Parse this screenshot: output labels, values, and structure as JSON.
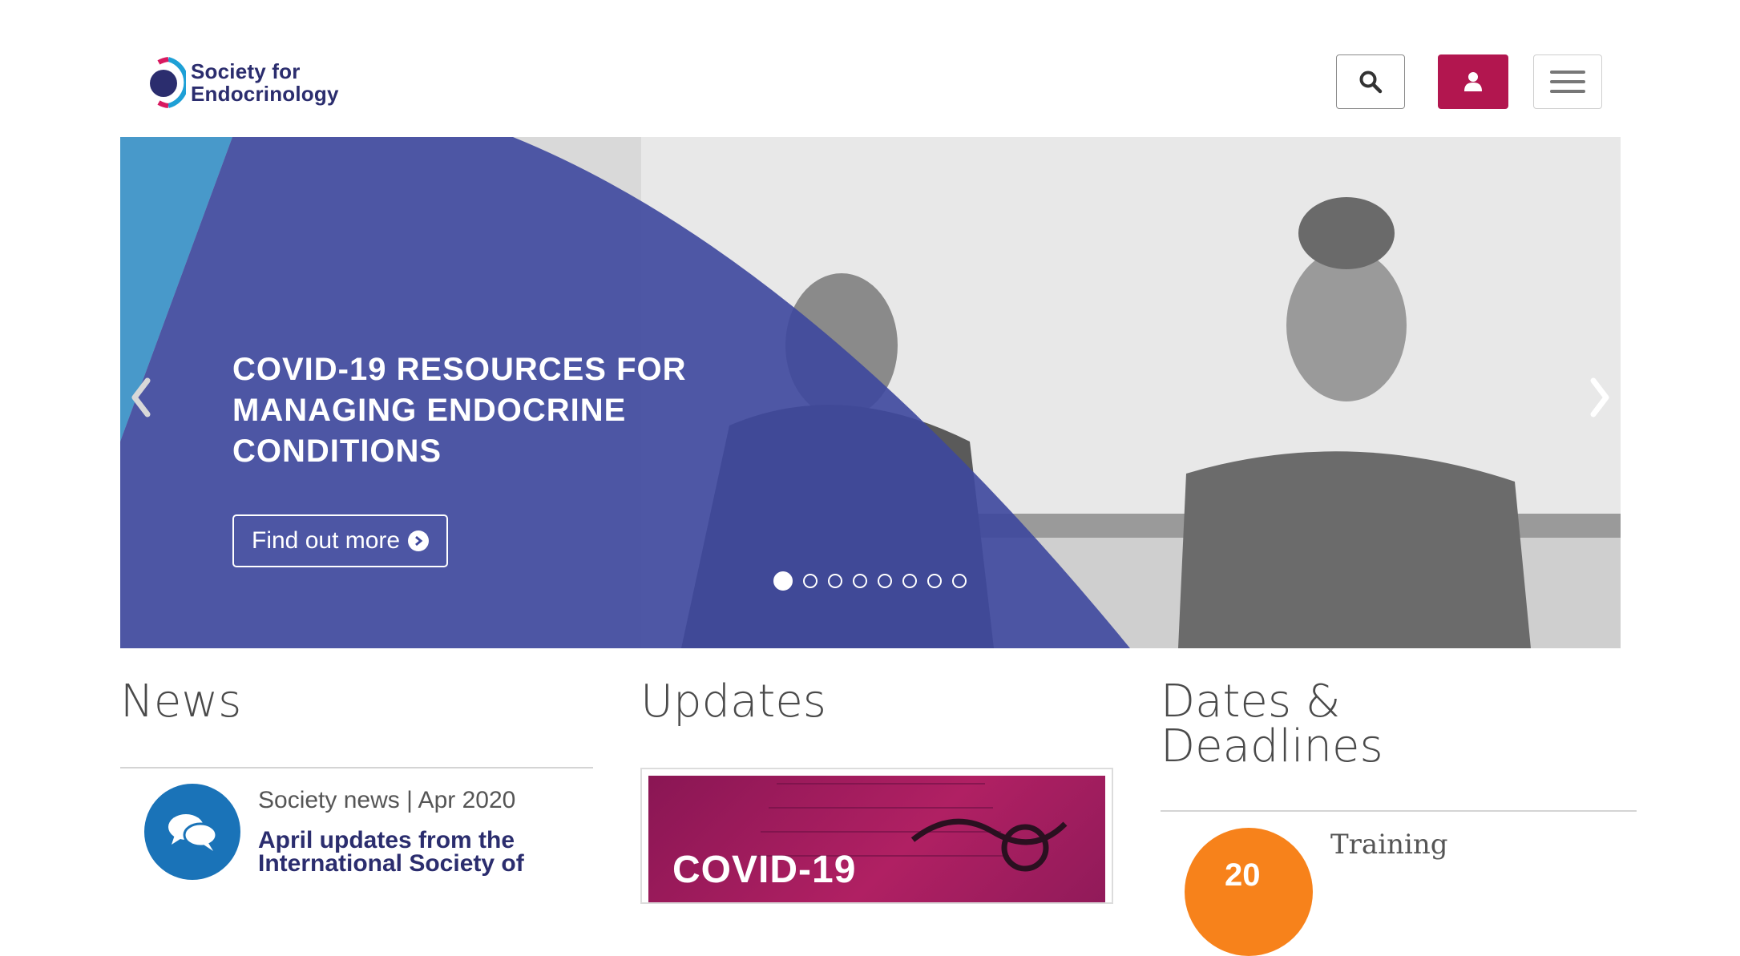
{
  "header": {
    "logo_line1": "Society for",
    "logo_line2": "Endocrinology",
    "icons": {
      "search": "search-icon",
      "user": "user-icon",
      "menu": "hamburger-menu-icon"
    },
    "colors": {
      "brand_navy": "#2b2d6e",
      "brand_magenta": "#b2164f",
      "accent_cyan": "#1ea0d6"
    }
  },
  "hero": {
    "title": "COVID-19 RESOURCES FOR MANAGING ENDOCRINE CONDITIONS",
    "cta_label": "Find out more",
    "slide_count": 8,
    "active_slide": 1,
    "overlay_color": "#4b54a7"
  },
  "news": {
    "heading": "News",
    "item": {
      "meta": "Society news | Apr 2020",
      "title": "April updates from the International Society of",
      "icon": "chat-bubbles-icon"
    }
  },
  "updates": {
    "heading": "Updates",
    "card_label": "COVID-19"
  },
  "dates": {
    "heading": "Dates & Deadlines",
    "item": {
      "day": "20",
      "type": "Training"
    }
  }
}
